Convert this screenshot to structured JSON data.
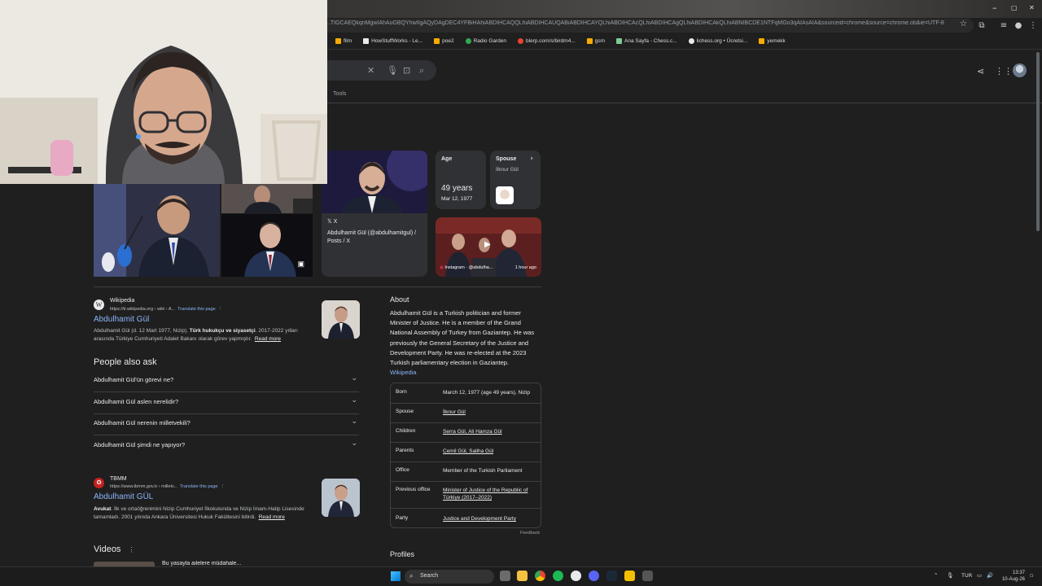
{
  "browser": {
    "url": "...TIGCAEQkqnMgwIAhAuGBQYhwIIgAQyDAgDEC4YFBiHAhiABDIHCAQQLhiABDIHCAUQABiABDIHCAYQLhiABDIHCAcQLhiABDIHCAgQLhiABDIHCAkQLhiABNIBCDE1NTFqMGo3qAIAsAIA&sourceid=chrome&source=chrome.ob&ie=UTF-8",
    "window_controls": [
      "–",
      "▢",
      "✕"
    ],
    "bookmarks": [
      {
        "label": "film",
        "color": "#f9ab00"
      },
      {
        "label": "HowStuffWorks - Le...",
        "color": "#e8eaed"
      },
      {
        "label": "poe2",
        "color": "#f9ab00"
      },
      {
        "label": "Radio Garden",
        "color": "#34a853"
      },
      {
        "label": "blerp.com/s/birdm4...",
        "color": "#ea4335"
      },
      {
        "label": "gsm",
        "color": "#f9ab00"
      },
      {
        "label": "Ana Sayfa - Chess.c...",
        "color": "#81c995"
      },
      {
        "label": "lichess.org • Ücretsi...",
        "color": "#e8eaed"
      },
      {
        "label": "yemekk",
        "color": "#f9ab00"
      }
    ]
  },
  "search": {
    "tools_label": "Tools"
  },
  "knowledge": {
    "x_card": {
      "source": "X",
      "title": "Abdulhamit Gül (@abdulhamitgul) / Posts / X"
    },
    "age": {
      "label": "Age",
      "value": "49 years",
      "sub": "Mar 12, 1977"
    },
    "spouse": {
      "label": "Spouse",
      "value": "İlknur Gül"
    },
    "video": {
      "source": "Instagram · @abdulha...",
      "time": "1 hour ago"
    }
  },
  "results": [
    {
      "site": "Wikipedia",
      "url": "https://tr.wikipedia.org › wiki › A...",
      "translate": "Translate this page",
      "title": "Abdulhamit Gül",
      "snippet_pre": "Abdulhamit Gül (d. 12 Mart 1977, Nizip), ",
      "snippet_bold": "Türk hukukçu ve siyasetçi",
      "snippet_post": ". 2017-2022 yılları arasında Türkiye Cumhuriyeti Adalet Bakanı olarak görev yapmıştır.",
      "read_more": "Read more"
    },
    {
      "site": "TBMM",
      "url": "https://www.tbmm.gov.tr › milletv...",
      "translate": "Translate this page",
      "title": "Abdulhamit GÜL",
      "snippet_bold": "Avukat",
      "snippet_post": ". İlk ve ortaöğrenimini Nizip Cumhuriyet İlkokulunda ve Nizip İmam-Hatip Lisesinde tamamladı. 2001 yılında Ankara Üniversitesi Hukuk Fakültesini bitirdi.",
      "read_more": "Read more"
    }
  ],
  "people_also_ask": {
    "title": "People also ask",
    "questions": [
      "Abdulhamit Gül'ün görevi ne?",
      "Abdulhamit Gül aslen nerelidir?",
      "Abdulhamit Gül nerenin milletvekili?",
      "Abdulhamit Gül şimdi ne yapıyor?"
    ]
  },
  "videos_title": "Videos",
  "videos_snippet": "Bu yasayla ailelere müdahale...",
  "about": {
    "title": "About",
    "text": "Abdulhamit Gül is a Turkish politician and former Minister of Justice. He is a member of the Grand National Assembly of Turkey from Gaziantep. He was previously the General Secretary of the Justice and Development Party. He was re-elected at the 2023 Turkish parliamentary election in Gaziantep.",
    "link": "Wikipedia",
    "facts": [
      {
        "k": "Born",
        "v": "March 12, 1977 (age 49 years), Nizip"
      },
      {
        "k": "Spouse",
        "v": "İlknur Gül"
      },
      {
        "k": "Children",
        "v": "Serra Gül, Ali Hamza Gül"
      },
      {
        "k": "Parents",
        "v": "Cemil Gül, Saliha Gül"
      },
      {
        "k": "Office",
        "v": "Member of the Turkish Parliament"
      },
      {
        "k": "Previous office",
        "v": "Minister of Justice of the Republic of Türkiye (2017–2022)"
      },
      {
        "k": "Party",
        "v": "Justice and Development Party"
      }
    ],
    "feedback": "Feedback",
    "profiles": "Profiles"
  },
  "taskbar": {
    "search_label": "Search",
    "lang": "TUR",
    "time": "13:37",
    "date": "10-Aug-26"
  }
}
